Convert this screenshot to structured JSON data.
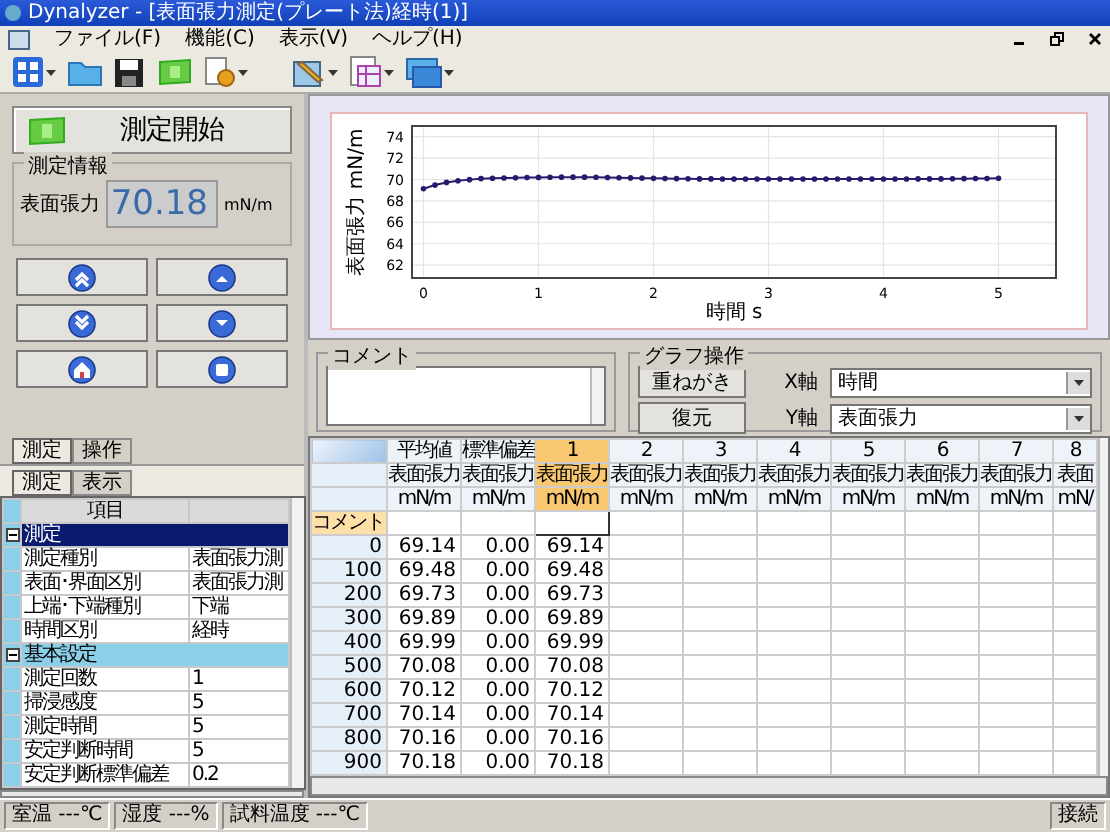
{
  "window": {
    "title": "Dynalyzer - [表面張力測定(プレート法)経時(1)]"
  },
  "menu": [
    {
      "label": "ファイル(F)"
    },
    {
      "label": "機能(C)"
    },
    {
      "label": "表示(V)"
    },
    {
      "label": "ヘルプ(H)"
    }
  ],
  "control_panel": {
    "start_button": "測定開始",
    "info_group": {
      "title": "測定情報",
      "label": "表面張力",
      "value": "70.18",
      "unit": "mN/m"
    },
    "tabs": [
      {
        "label": "測定",
        "selected": true
      },
      {
        "label": "操作",
        "selected": false
      }
    ]
  },
  "property_panel": {
    "tabs": [
      {
        "label": "測定",
        "selected": true
      },
      {
        "label": "表示",
        "selected": false
      }
    ],
    "column_header": "項目",
    "groups": [
      {
        "name": "測定",
        "expanded": true,
        "selected": true,
        "items": [
          {
            "name": "測定種別",
            "value": "表面張力測"
          },
          {
            "name": "表面･界面区別",
            "value": "表面張力測"
          },
          {
            "name": "上端･下端種別",
            "value": "下端"
          },
          {
            "name": "時間区別",
            "value": "経時"
          }
        ]
      },
      {
        "name": "基本設定",
        "expanded": true,
        "selected": false,
        "items": [
          {
            "name": "測定回数",
            "value": "1"
          },
          {
            "name": "掃浸感度",
            "value": "5"
          },
          {
            "name": "測定時間",
            "value": "5"
          },
          {
            "name": "安定判断時間",
            "value": "5"
          },
          {
            "name": "安定判断標準偏差",
            "value": "0.2"
          }
        ]
      }
    ]
  },
  "graph": {
    "chart_data": {
      "type": "line",
      "grid": true,
      "xlabel": "時間 s",
      "ylabel": "表面張力 mN/m",
      "xlim": [
        -0.1,
        5.5
      ],
      "ylim": [
        60.8,
        75
      ],
      "xticks": [
        0,
        1,
        2,
        3,
        4,
        5
      ],
      "yticks": [
        62,
        64,
        66,
        68,
        70,
        72,
        74
      ],
      "x": [
        0,
        0.1,
        0.2,
        0.3,
        0.4,
        0.5,
        0.6,
        0.7,
        0.8,
        0.9,
        1,
        1.1,
        1.2,
        1.3,
        1.4,
        1.5,
        1.6,
        1.7,
        1.8,
        1.9,
        2,
        2.1,
        2.2,
        2.3,
        2.4,
        2.5,
        2.6,
        2.7,
        2.8,
        2.9,
        3,
        3.1,
        3.2,
        3.3,
        3.4,
        3.5,
        3.6,
        3.7,
        3.8,
        3.9,
        4,
        4.1,
        4.2,
        4.3,
        4.4,
        4.5,
        4.6,
        4.7,
        4.8,
        4.9,
        5
      ],
      "series": [
        {
          "color": "#2a1a6e",
          "values": [
            69.14,
            69.48,
            69.73,
            69.89,
            69.99,
            70.08,
            70.12,
            70.14,
            70.16,
            70.18,
            70.2,
            70.21,
            70.22,
            70.22,
            70.22,
            70.21,
            70.19,
            70.17,
            70.15,
            70.13,
            70.11,
            70.09,
            70.08,
            70.07,
            70.06,
            70.06,
            70.05,
            70.05,
            70.05,
            70.05,
            70.05,
            70.05,
            70.05,
            70.05,
            70.05,
            70.05,
            70.05,
            70.05,
            70.05,
            70.05,
            70.05,
            70.05,
            70.05,
            70.06,
            70.06,
            70.06,
            70.07,
            70.08,
            70.09,
            70.1,
            70.12
          ]
        }
      ]
    }
  },
  "comment": {
    "title": "コメント"
  },
  "graph_ops": {
    "title": "グラフ操作",
    "buttons": [
      "重ねがき",
      "復元"
    ],
    "x_axis": {
      "label": "X軸",
      "value": "時間"
    },
    "y_axis": {
      "label": "Y軸",
      "value": "表面張力"
    }
  },
  "table": {
    "comment_label": "コメント",
    "columns": [
      {
        "title": "平均値",
        "quantity": "表面張力",
        "unit": "mN/m",
        "selected": false
      },
      {
        "title": "標準偏差",
        "quantity": "表面張力",
        "unit": "mN/m",
        "selected": false
      },
      {
        "title": "1",
        "quantity": "表面張力",
        "unit": "mN/m",
        "selected": true
      },
      {
        "title": "2",
        "quantity": "表面張力",
        "unit": "mN/m",
        "selected": false
      },
      {
        "title": "3",
        "quantity": "表面張力",
        "unit": "mN/m",
        "selected": false
      },
      {
        "title": "4",
        "quantity": "表面張力",
        "unit": "mN/m",
        "selected": false
      },
      {
        "title": "5",
        "quantity": "表面張力",
        "unit": "mN/m",
        "selected": false
      },
      {
        "title": "6",
        "quantity": "表面張力",
        "unit": "mN/m",
        "selected": false
      },
      {
        "title": "7",
        "quantity": "表面張力",
        "unit": "mN/m",
        "selected": false
      },
      {
        "title": "8",
        "quantity": "表面",
        "unit": "mN/",
        "selected": false
      }
    ],
    "rows": [
      {
        "time": "0",
        "cells": [
          "69.14",
          "0.00",
          "69.14"
        ]
      },
      {
        "time": "100",
        "cells": [
          "69.48",
          "0.00",
          "69.48"
        ]
      },
      {
        "time": "200",
        "cells": [
          "69.73",
          "0.00",
          "69.73"
        ]
      },
      {
        "time": "300",
        "cells": [
          "69.89",
          "0.00",
          "69.89"
        ]
      },
      {
        "time": "400",
        "cells": [
          "69.99",
          "0.00",
          "69.99"
        ]
      },
      {
        "time": "500",
        "cells": [
          "70.08",
          "0.00",
          "70.08"
        ]
      },
      {
        "time": "600",
        "cells": [
          "70.12",
          "0.00",
          "70.12"
        ]
      },
      {
        "time": "700",
        "cells": [
          "70.14",
          "0.00",
          "70.14"
        ]
      },
      {
        "time": "800",
        "cells": [
          "70.16",
          "0.00",
          "70.16"
        ]
      },
      {
        "time": "900",
        "cells": [
          "70.18",
          "0.00",
          "70.18"
        ]
      }
    ]
  },
  "status_bar": {
    "items": [
      "室温 ---℃",
      "湿度 ---%",
      "試料温度 ---℃"
    ],
    "connection": "接続"
  }
}
